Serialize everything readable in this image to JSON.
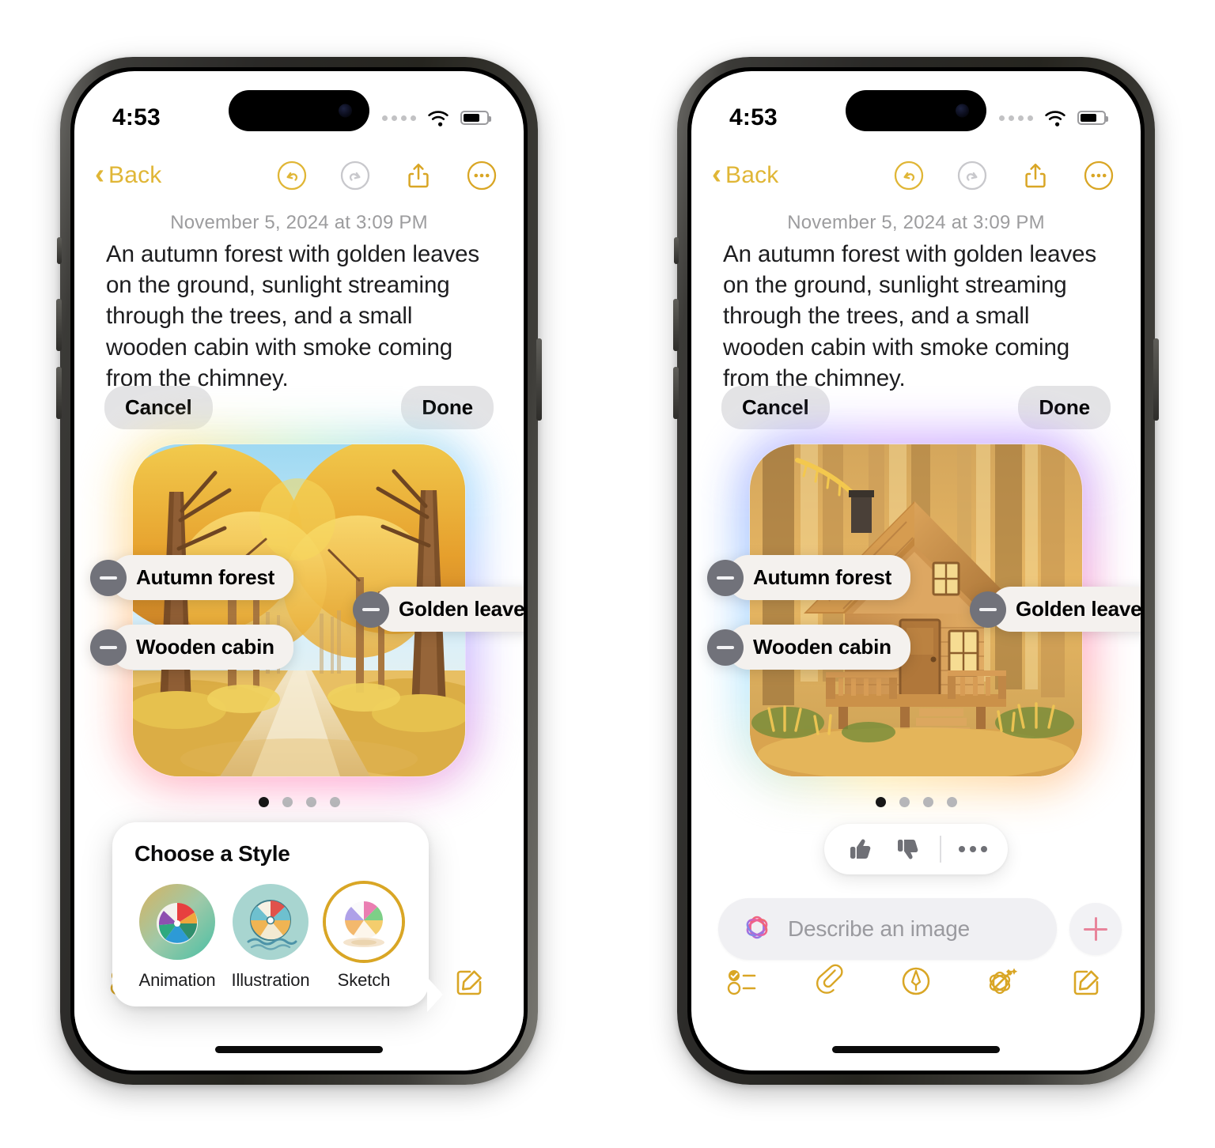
{
  "colors": {
    "accent_yellow": "#D9A625",
    "back_link": "#E0B636",
    "pill_bg": "#E3E3E5",
    "tag_bg": "#F4F1EE",
    "minus_bg": "#71727A",
    "plus_pink": "#E8849B",
    "disabled_grey": "#C8C8CC"
  },
  "status_bar": {
    "time": "4:53",
    "signal_icon": "signal-dots-icon",
    "wifi_icon": "wifi-icon",
    "battery_icon": "battery-icon",
    "battery_level": "72%"
  },
  "nav": {
    "back_label": "Back",
    "back_icon": "chevron-left-icon",
    "undo_icon": "undo-icon",
    "redo_icon": "redo-icon",
    "share_icon": "share-icon",
    "more_icon": "ellipsis-circle-icon",
    "undo_state": "enabled",
    "redo_state": "disabled"
  },
  "note": {
    "date": "November 5, 2024 at 3:09 PM",
    "body": "An autumn forest with golden leaves on the ground, sunlight streaming through the trees, and a small wooden cabin with smoke coming from the chimney."
  },
  "actions": {
    "cancel_label": "Cancel",
    "done_label": "Done"
  },
  "concept_tags": [
    {
      "label": "Autumn forest",
      "remove_icon": "minus-circle-icon"
    },
    {
      "label": "Wooden cabin",
      "remove_icon": "minus-circle-icon"
    },
    {
      "label": "Golden leaves",
      "remove_icon": "minus-circle-icon"
    }
  ],
  "pager": {
    "total": 4,
    "active_index": 0
  },
  "left_phone": {
    "image_alt": "Autumn forest path with golden trees and blue sky",
    "style_popover": {
      "title": "Choose a Style",
      "options": [
        {
          "label": "Animation",
          "icon": "beachball-animation-icon",
          "selected": false
        },
        {
          "label": "Illustration",
          "icon": "beachball-illustration-icon",
          "selected": false
        },
        {
          "label": "Sketch",
          "icon": "beachball-sketch-icon",
          "selected": true
        }
      ]
    },
    "compose_plus_icon": "plus-icon",
    "image_playground_icon": "image-playground-icon"
  },
  "right_phone": {
    "image_alt": "Wooden cabin in a golden autumn forest",
    "feedback": {
      "thumbs_up_icon": "thumbs-up-icon",
      "thumbs_down_icon": "thumbs-down-icon",
      "more_icon": "ellipsis-icon"
    },
    "describe": {
      "placeholder": "Describe an image",
      "leading_icon": "image-playground-icon",
      "value": ""
    },
    "compose_plus_icon": "plus-icon"
  },
  "toolbar": {
    "items": [
      {
        "name": "checklist",
        "icon": "checklist-icon"
      },
      {
        "name": "attachment",
        "icon": "paperclip-icon"
      },
      {
        "name": "markup",
        "icon": "markup-pen-icon"
      },
      {
        "name": "image-playground",
        "icon": "image-playground-wand-icon"
      },
      {
        "name": "compose",
        "icon": "compose-icon"
      }
    ]
  }
}
